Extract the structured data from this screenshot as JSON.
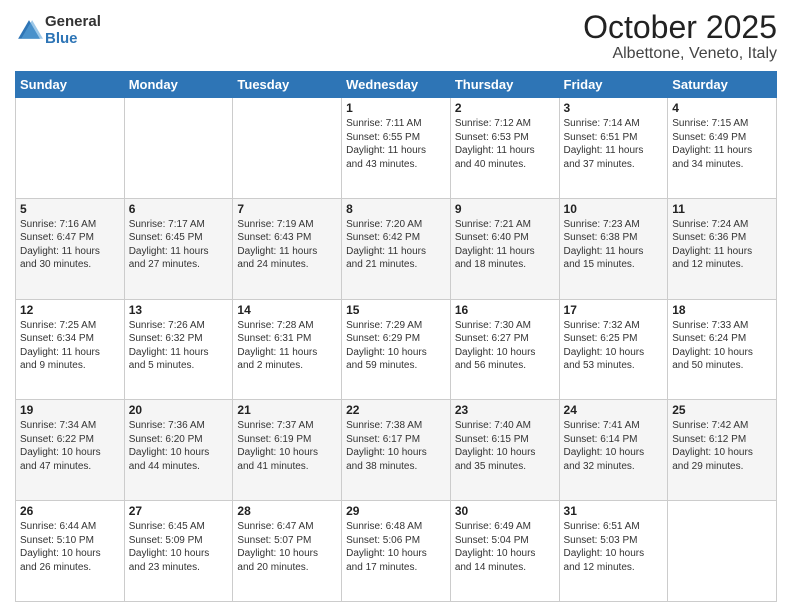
{
  "header": {
    "logo_line1": "General",
    "logo_line2": "Blue",
    "title": "October 2025",
    "subtitle": "Albettone, Veneto, Italy"
  },
  "calendar": {
    "days_of_week": [
      "Sunday",
      "Monday",
      "Tuesday",
      "Wednesday",
      "Thursday",
      "Friday",
      "Saturday"
    ],
    "weeks": [
      [
        {
          "day": "",
          "info": ""
        },
        {
          "day": "",
          "info": ""
        },
        {
          "day": "",
          "info": ""
        },
        {
          "day": "1",
          "info": "Sunrise: 7:11 AM\nSunset: 6:55 PM\nDaylight: 11 hours\nand 43 minutes."
        },
        {
          "day": "2",
          "info": "Sunrise: 7:12 AM\nSunset: 6:53 PM\nDaylight: 11 hours\nand 40 minutes."
        },
        {
          "day": "3",
          "info": "Sunrise: 7:14 AM\nSunset: 6:51 PM\nDaylight: 11 hours\nand 37 minutes."
        },
        {
          "day": "4",
          "info": "Sunrise: 7:15 AM\nSunset: 6:49 PM\nDaylight: 11 hours\nand 34 minutes."
        }
      ],
      [
        {
          "day": "5",
          "info": "Sunrise: 7:16 AM\nSunset: 6:47 PM\nDaylight: 11 hours\nand 30 minutes."
        },
        {
          "day": "6",
          "info": "Sunrise: 7:17 AM\nSunset: 6:45 PM\nDaylight: 11 hours\nand 27 minutes."
        },
        {
          "day": "7",
          "info": "Sunrise: 7:19 AM\nSunset: 6:43 PM\nDaylight: 11 hours\nand 24 minutes."
        },
        {
          "day": "8",
          "info": "Sunrise: 7:20 AM\nSunset: 6:42 PM\nDaylight: 11 hours\nand 21 minutes."
        },
        {
          "day": "9",
          "info": "Sunrise: 7:21 AM\nSunset: 6:40 PM\nDaylight: 11 hours\nand 18 minutes."
        },
        {
          "day": "10",
          "info": "Sunrise: 7:23 AM\nSunset: 6:38 PM\nDaylight: 11 hours\nand 15 minutes."
        },
        {
          "day": "11",
          "info": "Sunrise: 7:24 AM\nSunset: 6:36 PM\nDaylight: 11 hours\nand 12 minutes."
        }
      ],
      [
        {
          "day": "12",
          "info": "Sunrise: 7:25 AM\nSunset: 6:34 PM\nDaylight: 11 hours\nand 9 minutes."
        },
        {
          "day": "13",
          "info": "Sunrise: 7:26 AM\nSunset: 6:32 PM\nDaylight: 11 hours\nand 5 minutes."
        },
        {
          "day": "14",
          "info": "Sunrise: 7:28 AM\nSunset: 6:31 PM\nDaylight: 11 hours\nand 2 minutes."
        },
        {
          "day": "15",
          "info": "Sunrise: 7:29 AM\nSunset: 6:29 PM\nDaylight: 10 hours\nand 59 minutes."
        },
        {
          "day": "16",
          "info": "Sunrise: 7:30 AM\nSunset: 6:27 PM\nDaylight: 10 hours\nand 56 minutes."
        },
        {
          "day": "17",
          "info": "Sunrise: 7:32 AM\nSunset: 6:25 PM\nDaylight: 10 hours\nand 53 minutes."
        },
        {
          "day": "18",
          "info": "Sunrise: 7:33 AM\nSunset: 6:24 PM\nDaylight: 10 hours\nand 50 minutes."
        }
      ],
      [
        {
          "day": "19",
          "info": "Sunrise: 7:34 AM\nSunset: 6:22 PM\nDaylight: 10 hours\nand 47 minutes."
        },
        {
          "day": "20",
          "info": "Sunrise: 7:36 AM\nSunset: 6:20 PM\nDaylight: 10 hours\nand 44 minutes."
        },
        {
          "day": "21",
          "info": "Sunrise: 7:37 AM\nSunset: 6:19 PM\nDaylight: 10 hours\nand 41 minutes."
        },
        {
          "day": "22",
          "info": "Sunrise: 7:38 AM\nSunset: 6:17 PM\nDaylight: 10 hours\nand 38 minutes."
        },
        {
          "day": "23",
          "info": "Sunrise: 7:40 AM\nSunset: 6:15 PM\nDaylight: 10 hours\nand 35 minutes."
        },
        {
          "day": "24",
          "info": "Sunrise: 7:41 AM\nSunset: 6:14 PM\nDaylight: 10 hours\nand 32 minutes."
        },
        {
          "day": "25",
          "info": "Sunrise: 7:42 AM\nSunset: 6:12 PM\nDaylight: 10 hours\nand 29 minutes."
        }
      ],
      [
        {
          "day": "26",
          "info": "Sunrise: 6:44 AM\nSunset: 5:10 PM\nDaylight: 10 hours\nand 26 minutes."
        },
        {
          "day": "27",
          "info": "Sunrise: 6:45 AM\nSunset: 5:09 PM\nDaylight: 10 hours\nand 23 minutes."
        },
        {
          "day": "28",
          "info": "Sunrise: 6:47 AM\nSunset: 5:07 PM\nDaylight: 10 hours\nand 20 minutes."
        },
        {
          "day": "29",
          "info": "Sunrise: 6:48 AM\nSunset: 5:06 PM\nDaylight: 10 hours\nand 17 minutes."
        },
        {
          "day": "30",
          "info": "Sunrise: 6:49 AM\nSunset: 5:04 PM\nDaylight: 10 hours\nand 14 minutes."
        },
        {
          "day": "31",
          "info": "Sunrise: 6:51 AM\nSunset: 5:03 PM\nDaylight: 10 hours\nand 12 minutes."
        },
        {
          "day": "",
          "info": ""
        }
      ]
    ]
  }
}
